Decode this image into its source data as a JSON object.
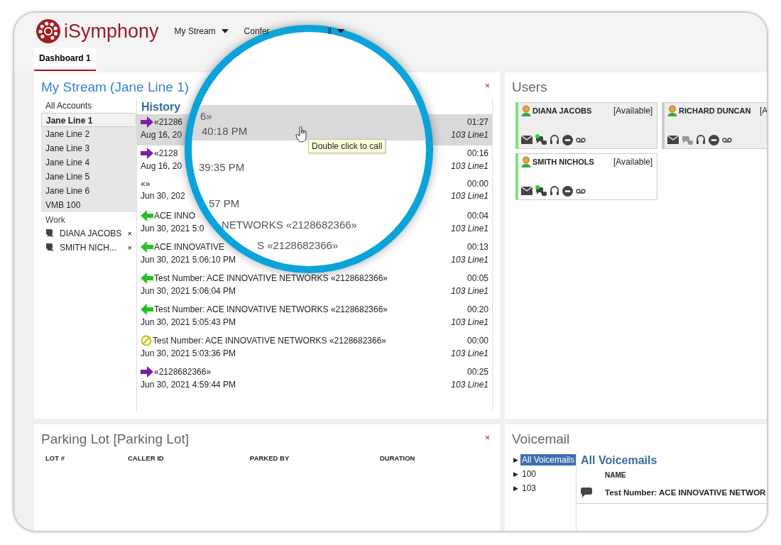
{
  "app": {
    "name": "iSymphony"
  },
  "nav": [
    {
      "label": "My Stream",
      "caret": true
    },
    {
      "label": "Confer",
      "caret": false
    },
    {
      "label": "ll",
      "caret": true
    }
  ],
  "tabs": [
    {
      "label": "Dashboard 1",
      "selected": true
    }
  ],
  "my_stream": {
    "title": "My Stream (Jane Line 1)",
    "close": "×",
    "accounts_label": "All Accounts",
    "accounts": [
      {
        "label": "Jane Line 1",
        "selected": true
      },
      {
        "label": "Jane Line 2",
        "selected": false
      },
      {
        "label": "Jane Line 3",
        "selected": false
      },
      {
        "label": "Jane Line 4",
        "selected": false
      },
      {
        "label": "Jane Line 5",
        "selected": false
      },
      {
        "label": "Jane Line 6",
        "selected": false
      },
      {
        "label": "VMB 100",
        "selected": false
      }
    ],
    "work_label": "Work",
    "work": [
      {
        "name": "DIANA JACOBS",
        "close": "×"
      },
      {
        "name": "SMITH NICH...",
        "close": "×"
      }
    ],
    "history_title": "History",
    "history": [
      {
        "kind": "outgoing",
        "caller": "«21286",
        "date": "Aug 16, 20",
        "duration": "01:27",
        "line": "103 Line1",
        "selected": true
      },
      {
        "kind": "outgoing",
        "caller": "«2128",
        "date": "Aug 16, 20",
        "duration": "00:16",
        "line": "103 Line1",
        "selected": false
      },
      {
        "kind": "none",
        "caller": "«»",
        "date": "Jun 30, 202",
        "duration": "00:00",
        "line": "103 Line1",
        "selected": false
      },
      {
        "kind": "incoming",
        "caller": "ACE INNO",
        "date": "Jun 30, 2021 5:0",
        "duration": "00:04",
        "line": "103 Line1",
        "selected": false
      },
      {
        "kind": "incoming",
        "caller": "ACE INNOVATIVE",
        "date": "Jun 30, 2021 5:06:10 PM",
        "duration": "00:13",
        "line": "103 Line1",
        "selected": false
      },
      {
        "kind": "incoming",
        "caller": "Test Number: ACE INNOVATIVE NETWORKS «2128682366»",
        "date": "Jun 30, 2021 5:06:04 PM",
        "duration": "00:05",
        "line": "103 Line1",
        "selected": false
      },
      {
        "kind": "incoming",
        "caller": "Test Number: ACE INNOVATIVE NETWORKS «2128682366»",
        "date": "Jun 30, 2021 5:05:43 PM",
        "duration": "00:20",
        "line": "103 Line1",
        "selected": false
      },
      {
        "kind": "blocked",
        "caller": "Test Number: ACE INNOVATIVE NETWORKS «2128682366»",
        "date": "Jun 30, 2021 5:03:36 PM",
        "duration": "00:00",
        "line": "103 Line1",
        "selected": false
      },
      {
        "kind": "outgoing",
        "caller": "«2128682366»",
        "date": "Jun 30, 2021 4:59:44 PM",
        "duration": "00:25",
        "line": "103 Line1",
        "selected": false
      }
    ]
  },
  "users": {
    "title": "Users",
    "cards": [
      {
        "name": "DIANA JACOBS",
        "status": "[Available]",
        "online": true,
        "highlighted": true
      },
      {
        "name": "RICHARD DUNCAN",
        "status": "[A",
        "online": false,
        "highlighted": true
      },
      {
        "name": "SMITH NICHOLS",
        "status": "[Available]",
        "online": true,
        "highlighted": false
      }
    ]
  },
  "parking_lot": {
    "title": "Parking Lot [Parking Lot]",
    "close": "×",
    "columns": [
      "LOT #",
      "CALLER ID",
      "PARKED BY",
      "DURATION"
    ]
  },
  "voicemail": {
    "title": "Voicemail",
    "tree": [
      {
        "label": "All Voicemails",
        "selected": true
      },
      {
        "label": "100",
        "selected": false
      },
      {
        "label": "103",
        "selected": false
      }
    ],
    "tree_caret": "▶",
    "heading": "All Voicemails",
    "column": "NAME",
    "rows": [
      "Test Number: ACE INNOVATIVE NETWOR"
    ]
  },
  "magnifier": {
    "texts": [
      "6»",
      "40:18 PM",
      "39:35 PM",
      "57 PM",
      "NETWORKS «2128682366»",
      "S «2128682366»"
    ],
    "tooltip": "Double click to call"
  }
}
